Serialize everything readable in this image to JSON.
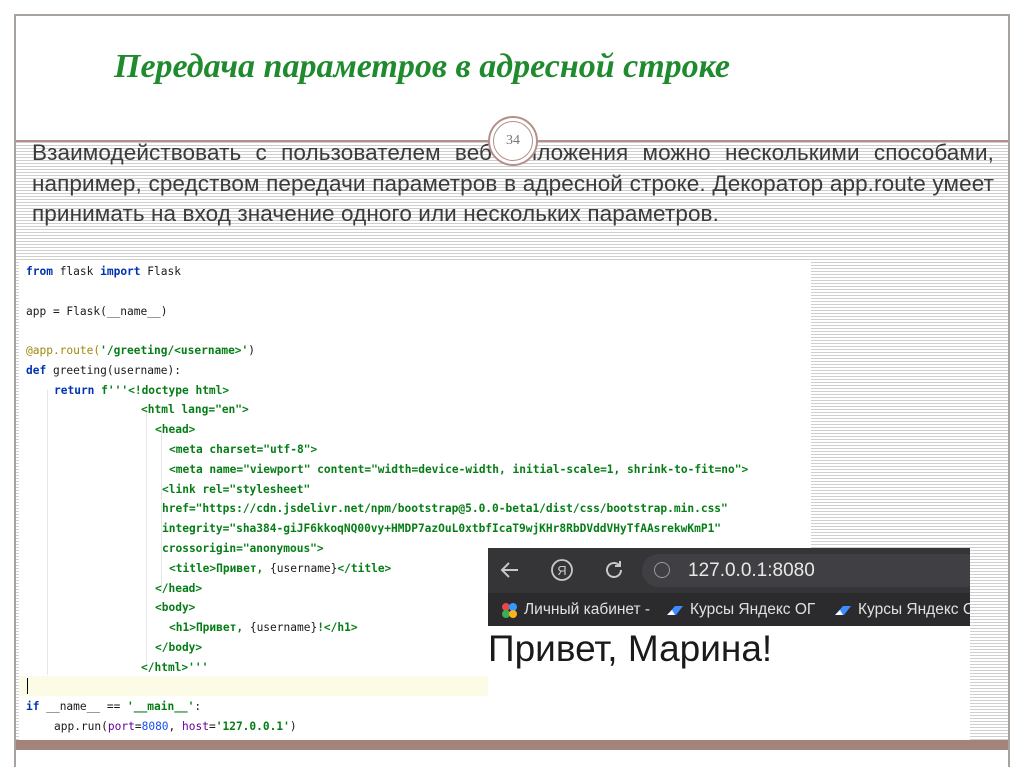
{
  "slide": {
    "title": "Передача параметров в адресной строке",
    "page_number": "34",
    "body": "Взаимодействовать с пользователем веб-приложения можно несколькими способами, например, средством передачи параметров в адресной строке. Декоратор app.route умеет принимать на вход значение одного или нескольких параметров."
  },
  "code": {
    "l1_kw": "from",
    "l1_mid": " flask ",
    "l1_kw2": "import",
    "l1_end": " Flask",
    "l3": "app = Flask(__name__)",
    "l5_deco": "@app.route(",
    "l5_str": "'/greeting/<username>'",
    "l5_end": ")",
    "l6_kw": "def",
    "l6_end": " greeting(username):",
    "l7_kw": "return",
    "l7_str": " f'''<!doctype html>",
    "l8": "<html lang=\"en\">",
    "l9": "<head>",
    "l10": "<meta charset=\"utf-8\">",
    "l11": "<meta name=\"viewport\" content=\"width=device-width, initial-scale=1, shrink-to-fit=no\">",
    "l12": "<link rel=\"stylesheet\"",
    "l13": "href=\"https://cdn.jsdelivr.net/npm/bootstrap@5.0.0-beta1/dist/css/bootstrap.min.css\"",
    "l14": "integrity=\"sha384-giJF6kkoqNQ00vy+HMDP7azOuL0xtbfIcaT9wjKHr8RbDVddVHyTfAAsrekwKmP1\"",
    "l15": "crossorigin=\"anonymous\">",
    "l16_a": "<title>Привет, ",
    "l16_b": "{username}",
    "l16_c": "</title>",
    "l17": "</head>",
    "l18": "<body>",
    "l19_a": "<h1>Привет, ",
    "l19_b": "{username}",
    "l19_c": "!</h1>",
    "l20": "</body>",
    "l21": "</html>'''",
    "l23_kw": "if",
    "l23_mid": " __name__ == ",
    "l23_str": "'__main__'",
    "l23_end": ":",
    "l24_a": "app.run(",
    "l24_p1": "port",
    "l24_eq1": "=",
    "l24_n1": "8080",
    "l24_c": ", ",
    "l24_p2": "host",
    "l24_eq2": "=",
    "l24_s2": "'127.0.0.1'",
    "l24_end": ")"
  },
  "browser": {
    "url": "127.0.0.1:8080",
    "bookmarks": [
      "Личный кабинет -",
      "Курсы Яндекс ОГ",
      "Курсы Яндекс С"
    ],
    "heading": "Привет, Марина!"
  },
  "colors": {
    "title_green": "#1f8a2e",
    "frame": "#a9a3a0",
    "accent": "#b3908a",
    "browser_toolbar": "#353538"
  }
}
